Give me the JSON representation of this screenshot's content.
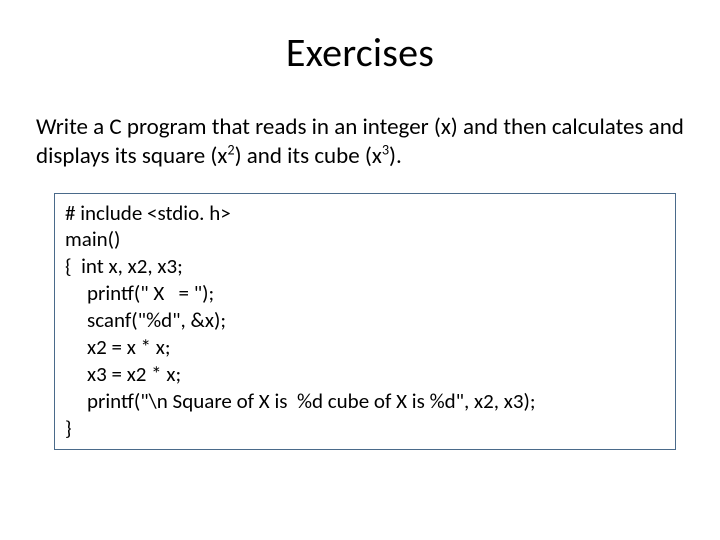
{
  "title": "Exercises",
  "prompt": {
    "part1": "Write a C program that reads in an integer (x) and then calculates and displays its square (x",
    "sup1": "2",
    "part2": ") and its cube (x",
    "sup2": "3",
    "part3": ")."
  },
  "code": {
    "l0": "# include <stdio. h>",
    "l1": "main()",
    "l2": "{  int x, x2, x3;",
    "l3": "printf(\" X   = \");",
    "l4": "scanf(\"%d\", &x);",
    "l5": "x2 = x * x;",
    "l6": "x3 = x2 * x;",
    "l7": "printf(\"\\n Square of X is  %d cube of X is %d\", x2, x3);",
    "l8": "}"
  }
}
